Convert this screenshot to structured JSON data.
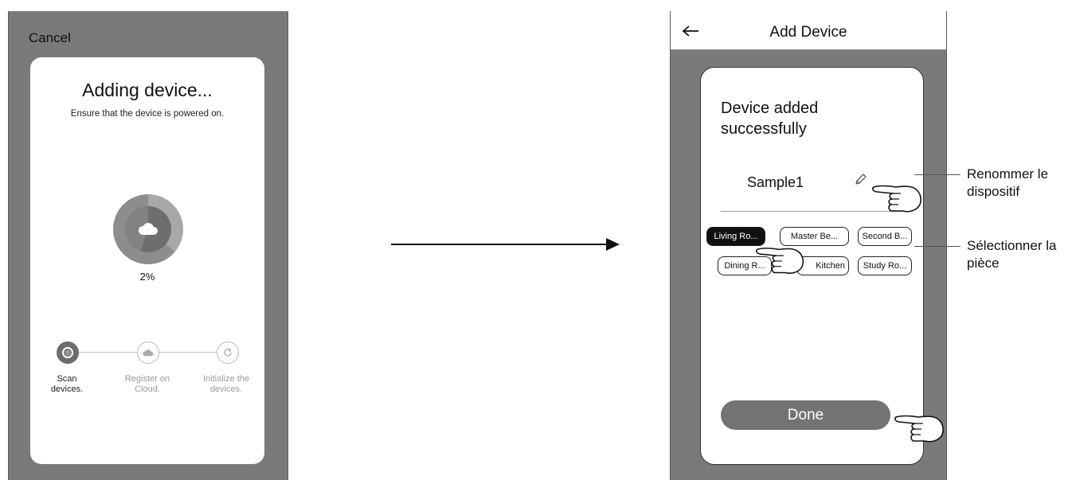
{
  "left_screen": {
    "cancel_label": "Cancel",
    "title": "Adding device...",
    "subtitle": "Ensure that the device is powered on.",
    "progress_text": "2%",
    "progress_value": 0.02,
    "steps": [
      {
        "label_line1": "Scan",
        "label_line2": "devices.",
        "icon": "refresh-icon",
        "state": "active"
      },
      {
        "label_line1": "Register on",
        "label_line2": "Cloud.",
        "icon": "cloud-icon",
        "state": "pending"
      },
      {
        "label_line1": "Initialize the",
        "label_line2": "devices.",
        "icon": "refresh-icon",
        "state": "pending"
      }
    ]
  },
  "right_screen": {
    "header_title": "Add Device",
    "success_line1": "Device added",
    "success_line2": "successfully",
    "device_name": "Sample1",
    "rooms": [
      "Living Ro...",
      "Master Be...",
      "Second B...",
      "Dining R...",
      "Kitchen",
      "Study Ro..."
    ],
    "selected_room": "Living Ro...",
    "done_label": "Done"
  },
  "annotations": {
    "rename_line1": "Renommer le",
    "rename_line2": "dispositif",
    "room_line1": "Sélectionner la",
    "room_line2": "pièce"
  },
  "colors": {
    "phone_background": "#7a7a7a",
    "selected_chip": "#111111",
    "done_button": "#737373"
  }
}
